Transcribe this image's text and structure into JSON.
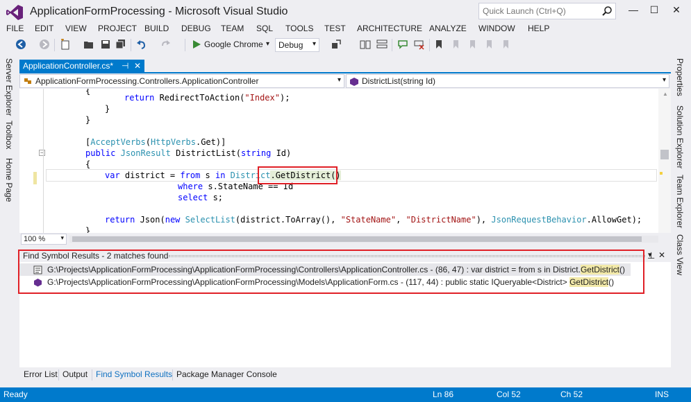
{
  "window": {
    "title": "ApplicationFormProcessing - Microsoft Visual Studio",
    "quick_launch_placeholder": "Quick Launch (Ctrl+Q)",
    "min": "—",
    "max": "☐",
    "close": "✕"
  },
  "menu": [
    "FILE",
    "EDIT",
    "VIEW",
    "PROJECT",
    "BUILD",
    "DEBUG",
    "TEAM",
    "SQL",
    "TOOLS",
    "TEST",
    "ARCHITECTURE",
    "ANALYZE",
    "WINDOW",
    "HELP"
  ],
  "toolbar": {
    "browser": "Google Chrome",
    "config": "Debug"
  },
  "left_tabs": [
    "Server Explorer",
    "Toolbox",
    "Home Page"
  ],
  "right_tabs": [
    "Properties",
    "Solution Explorer",
    "Team Explorer",
    "Class View"
  ],
  "doc_tab": {
    "label": "ApplicationController.cs*",
    "pin": "⊣",
    "close": "✕"
  },
  "navbar": {
    "class_combo": "ApplicationFormProcessing.Controllers.ApplicationController",
    "member_combo": "DistrictList(string Id)"
  },
  "code": {
    "l1": "{",
    "l2_kw": "return",
    "l2_a": " RedirectToAction(",
    "l2_str": "\"Index\"",
    "l2_b": ");",
    "l3": "}",
    "l4": "}",
    "l6_a": "[",
    "l6_t1": "AcceptVerbs",
    "l6_b": "(",
    "l6_t2": "HttpVerbs",
    "l6_c": ".Get)]",
    "l7_kw1": "public",
    "l7_t": "JsonResult",
    "l7_a": " DistrictList(",
    "l7_kw2": "string",
    "l7_b": " Id)",
    "l8": "{",
    "l9_kw1": "var",
    "l9_a": " district = ",
    "l9_kw2": "from",
    "l9_b": " s ",
    "l9_kw3": "in",
    "l9_c": " ",
    "l9_t": "District",
    "l9_d": ".GetDistrict()",
    "l10_kw": "where",
    "l10_a": " s.StateName == Id",
    "l11_kw": "select",
    "l11_a": " s;",
    "l13_kw1": "return",
    "l13_a": " Json(",
    "l13_kw2": "new",
    "l13_b": " ",
    "l13_t1": "SelectList",
    "l13_c": "(district.ToArray(), ",
    "l13_s1": "\"StateName\"",
    "l13_d": ", ",
    "l13_s2": "\"DistrictName\"",
    "l13_e": "), ",
    "l13_t2": "JsonRequestBehavior",
    "l13_f": ".AllowGet);",
    "l14": "}"
  },
  "zoom": "100 %",
  "find_panel": {
    "title": "Find Symbol Results - 2 matches found",
    "results": [
      {
        "path": "G:\\Projects\\ApplicationFormProcessing\\ApplicationFormProcessing\\Controllers\\ApplicationController.cs - (86, 47) : var district = from s in District.",
        "match": "GetDistrict",
        "tail": "()"
      },
      {
        "path": "G:\\Projects\\ApplicationFormProcessing\\ApplicationFormProcessing\\Models\\ApplicationForm.cs - (117, 44) : public static IQueryable<District> ",
        "match": "GetDistrict",
        "tail": "()"
      }
    ]
  },
  "bottom_tabs": [
    "Error List",
    "Output",
    "Find Symbol Results",
    "Package Manager Console"
  ],
  "status": {
    "ready": "Ready",
    "ln": "Ln 86",
    "col": "Col 52",
    "ch": "Ch 52",
    "ins": "INS"
  }
}
